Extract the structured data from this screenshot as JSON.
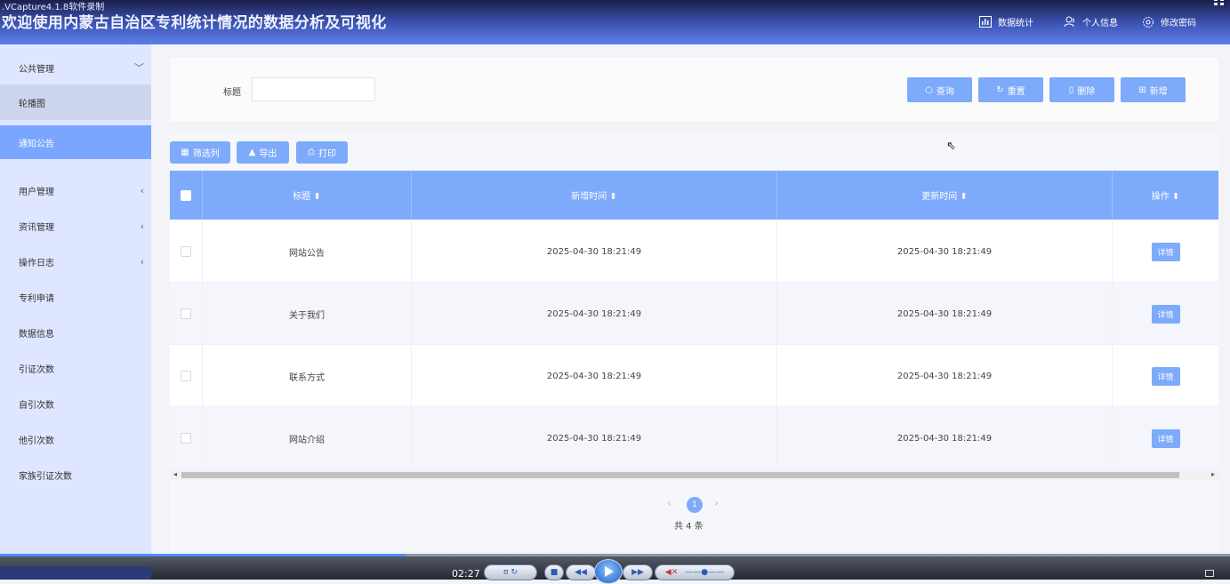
{
  "recorder": {
    "caption": ".VCapture4.1.8软件录制"
  },
  "header": {
    "title": "欢迎使用内蒙古自治区专利统计情况的数据分析及可视化",
    "nav": [
      {
        "label": "数据统计",
        "icon": "chart-icon"
      },
      {
        "label": "个人信息",
        "icon": "user-icon"
      },
      {
        "label": "修改密码",
        "icon": "gear-icon"
      }
    ]
  },
  "sidebar": {
    "items": [
      {
        "label": "公共管理",
        "arrow": "﹀"
      },
      {
        "label": "轮播图"
      },
      {
        "label": "通知公告"
      },
      {
        "label": "用户管理",
        "arrow": "‹"
      },
      {
        "label": "资讯管理",
        "arrow": "‹"
      },
      {
        "label": "操作日志",
        "arrow": "‹"
      },
      {
        "label": "专利申请"
      },
      {
        "label": "数据信息"
      },
      {
        "label": "引证次数"
      },
      {
        "label": "自引次数"
      },
      {
        "label": "他引次数"
      },
      {
        "label": "家族引证次数"
      }
    ]
  },
  "search": {
    "label": "标题",
    "value": "",
    "buttons": {
      "query": "查询",
      "reset": "重置",
      "delete": "删除",
      "add": "新增"
    }
  },
  "toolbar": {
    "filter": "筛选列",
    "export": "导出",
    "print": "打印"
  },
  "table": {
    "headers": {
      "title": "标题 ⬍",
      "created": "新增时间 ⬍",
      "updated": "更新时间 ⬍",
      "action": "操作 ⬍"
    },
    "rows": [
      {
        "title": "网站公告",
        "created": "2025-04-30 18:21:49",
        "updated": "2025-04-30 18:21:49",
        "action": "详情"
      },
      {
        "title": "关于我们",
        "created": "2025-04-30 18:21:49",
        "updated": "2025-04-30 18:21:49",
        "action": "详情"
      },
      {
        "title": "联系方式",
        "created": "2025-04-30 18:21:49",
        "updated": "2025-04-30 18:21:49",
        "action": "详情"
      },
      {
        "title": "网站介绍",
        "created": "2025-04-30 18:21:49",
        "updated": "2025-04-30 18:21:49",
        "action": "详情"
      }
    ]
  },
  "pagination": {
    "current": "1",
    "total": "共 4 条"
  },
  "player": {
    "time": "02:27",
    "progress": 0.33
  }
}
